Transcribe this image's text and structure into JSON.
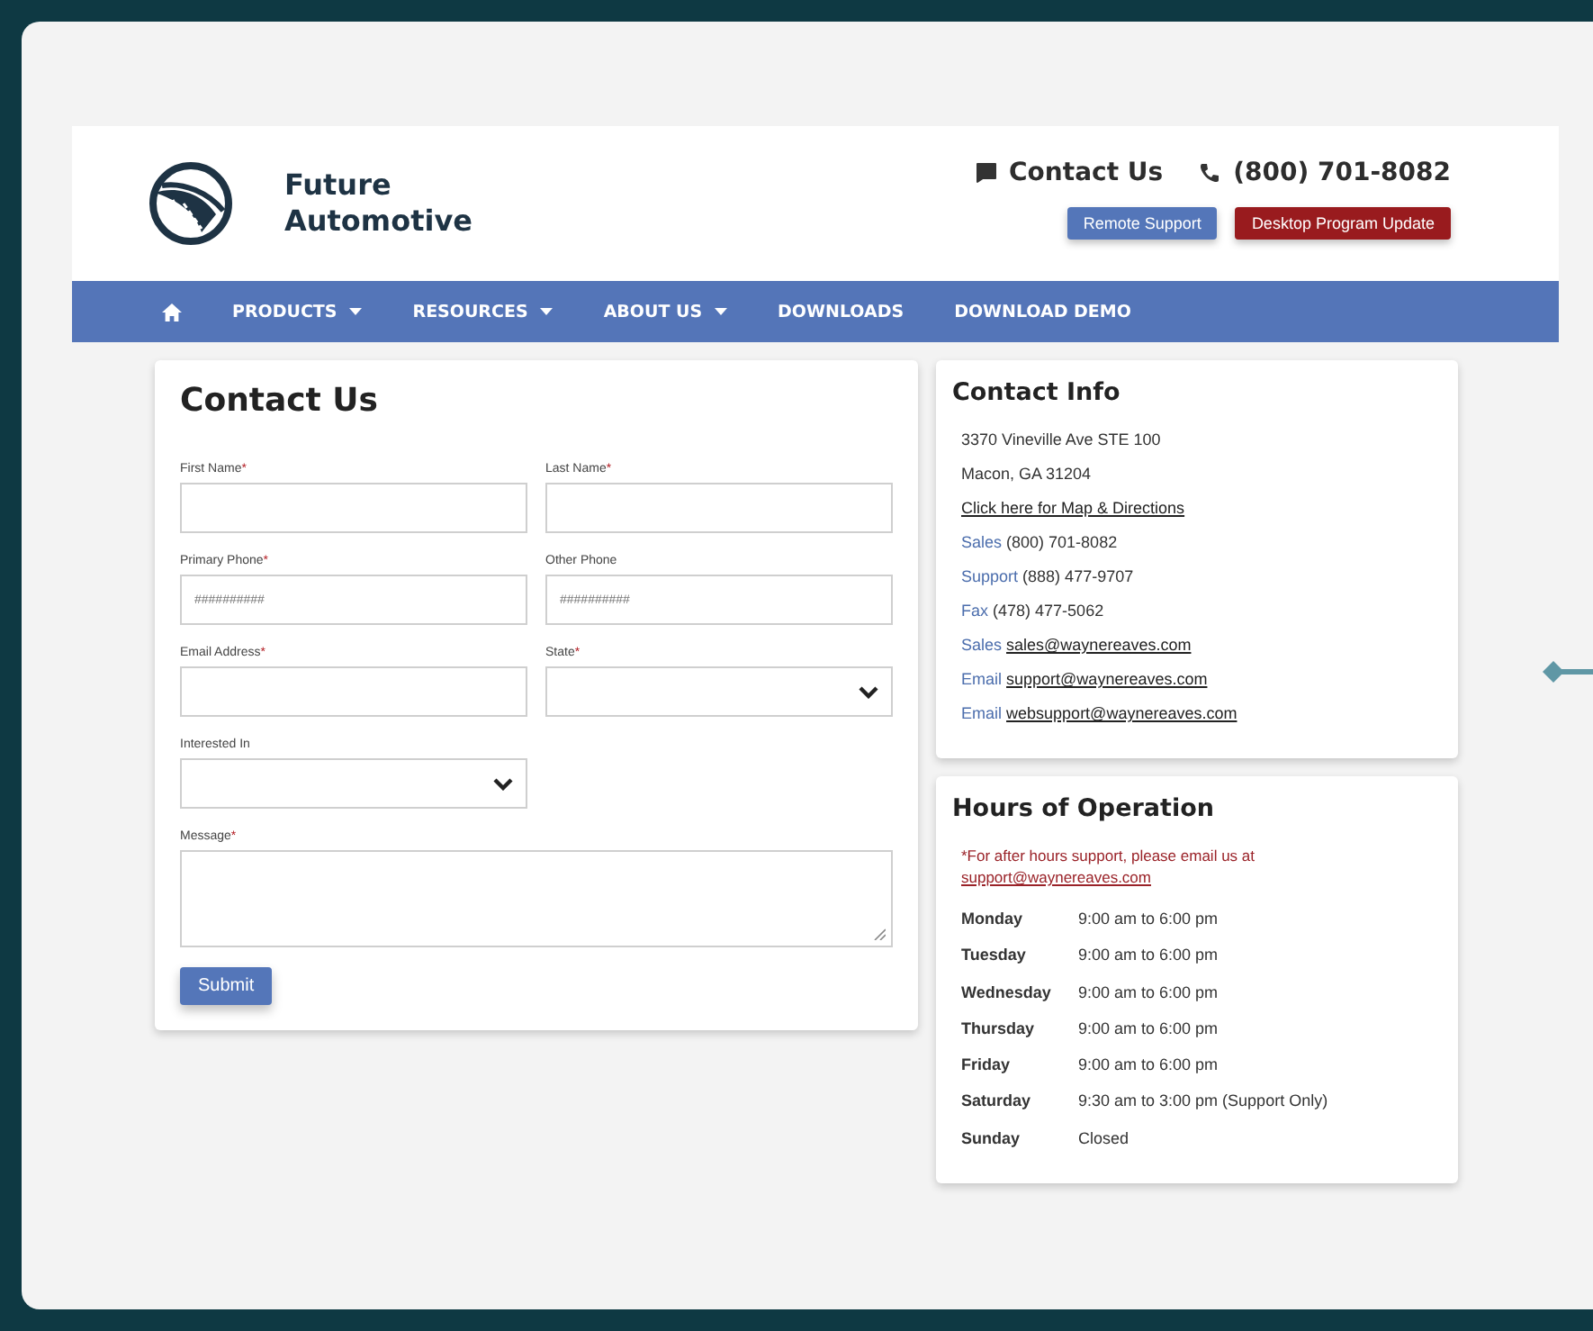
{
  "brand": {
    "line1": "Future",
    "line2": "Automotive"
  },
  "header": {
    "contact": "Contact Us",
    "phone": "(800) 701-8082",
    "buttons": [
      {
        "label": "Remote Support",
        "kind": "primary"
      },
      {
        "label": "Desktop Program Update",
        "kind": "danger"
      }
    ]
  },
  "nav": [
    {
      "kind": "home"
    },
    {
      "kind": "link",
      "label": "PRODUCTS",
      "dropdown": true
    },
    {
      "kind": "link",
      "label": "RESOURCES",
      "dropdown": true
    },
    {
      "kind": "link",
      "label": "ABOUT US",
      "dropdown": true
    },
    {
      "kind": "link",
      "label": "DOWNLOADS",
      "dropdown": false
    },
    {
      "kind": "link",
      "label": "DOWNLOAD DEMO",
      "dropdown": false
    }
  ],
  "form": {
    "title": "Contact Us",
    "fields": [
      {
        "label": "First Name",
        "mark": "*",
        "kind": "text"
      },
      {
        "label": "Last Name",
        "mark": "*",
        "kind": "text"
      },
      {
        "label": "Primary Phone",
        "mark": "*",
        "kind": "text",
        "placeholder": "##########"
      },
      {
        "label": "Other Phone",
        "kind": "text",
        "placeholder": "##########"
      },
      {
        "label": "Email Address",
        "mark": "*",
        "kind": "text"
      },
      {
        "label": "State",
        "mark": "*",
        "kind": "select"
      },
      {
        "label": "Interested In",
        "kind": "select"
      },
      {
        "label": "Message",
        "mark": "*",
        "kind": "textarea"
      }
    ],
    "submit": "Submit"
  },
  "contact_info": {
    "title": "Contact Info",
    "lines": [
      {
        "text": "3370 Vineville Ave STE 100",
        "link": false
      },
      {
        "text": "Macon, GA 31204",
        "link": false
      },
      {
        "text": "Click here for Map & Directions",
        "link": true
      },
      {
        "label": "Sales",
        "text": "(800) 701-8082",
        "link": false
      },
      {
        "label": "Support",
        "text": "(888) 477-9707",
        "link": false
      },
      {
        "label": "Fax",
        "text": "(478) 477-5062",
        "link": false
      },
      {
        "label": "Sales",
        "text": "sales@waynereaves.com",
        "link": true
      },
      {
        "label": "Email",
        "text": "support@waynereaves.com",
        "link": true
      },
      {
        "label": "Email",
        "text": "websupport@waynereaves.com",
        "link": true
      }
    ]
  },
  "hours": {
    "title": "Hours of Operation",
    "note": "*For after hours support, please email us at",
    "note_link": "support@waynereaves.com",
    "rows": [
      {
        "day": "Monday",
        "time": "9:00 am to 6:00 pm"
      },
      {
        "day": "Tuesday",
        "time": "9:00 am to 6:00 pm"
      },
      {
        "day": "Wednesday",
        "time": "9:00 am to 6:00 pm"
      },
      {
        "day": "Thursday",
        "time": "9:00 am to 6:00 pm"
      },
      {
        "day": "Friday",
        "time": "9:00 am to 6:00 pm"
      },
      {
        "day": "Saturday",
        "time": "9:30 am to 3:00 pm (Support Only)"
      },
      {
        "day": "Sunday",
        "time": "Closed"
      }
    ]
  }
}
